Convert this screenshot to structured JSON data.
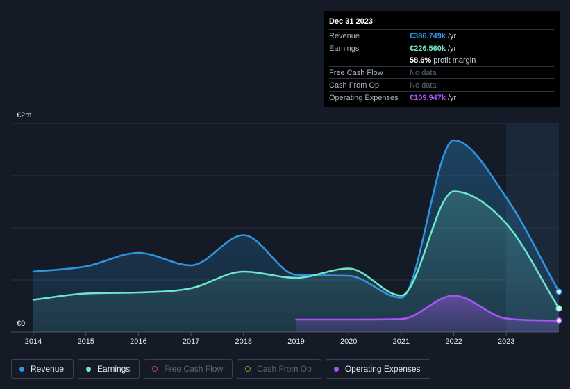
{
  "tooltip": {
    "date": "Dec 31 2023",
    "rows": [
      {
        "label": "Revenue",
        "value": "€386.749k",
        "unit": "/yr",
        "color": "#2f95e0"
      },
      {
        "label": "Earnings",
        "value": "€226.560k",
        "unit": "/yr",
        "color": "#6ee7c9"
      },
      {
        "label": "",
        "value": "58.6%",
        "unit": "profit margin",
        "color": "#ffffff"
      },
      {
        "label": "Free Cash Flow",
        "value": "No data",
        "unit": "",
        "color": "#5c6473"
      },
      {
        "label": "Cash From Op",
        "value": "No data",
        "unit": "",
        "color": "#5c6473"
      },
      {
        "label": "Operating Expenses",
        "value": "€109.947k",
        "unit": "/yr",
        "color": "#a855f7"
      }
    ]
  },
  "chart_data": {
    "type": "area",
    "y_axis": {
      "top_label": "€2m",
      "bottom_label": "€0",
      "ylim": [
        0,
        2000
      ]
    },
    "x_ticks": [
      "2014",
      "2015",
      "2016",
      "2017",
      "2018",
      "2019",
      "2020",
      "2021",
      "2022",
      "2023"
    ],
    "x_range": [
      2014.0,
      2024.0
    ],
    "units": "€k",
    "series": [
      {
        "name": "Revenue",
        "color": "#2f95e0",
        "points": [
          [
            2014.0,
            580
          ],
          [
            2015.0,
            630
          ],
          [
            2016.0,
            760
          ],
          [
            2017.0,
            640
          ],
          [
            2018.0,
            930
          ],
          [
            2019.0,
            550
          ],
          [
            2020.0,
            540
          ],
          [
            2021.0,
            330
          ],
          [
            2022.0,
            1840
          ],
          [
            2023.0,
            1290
          ],
          [
            2024.0,
            387
          ]
        ]
      },
      {
        "name": "Earnings",
        "color": "#6ee7c9",
        "points": [
          [
            2014.0,
            310
          ],
          [
            2015.0,
            370
          ],
          [
            2016.0,
            380
          ],
          [
            2017.0,
            420
          ],
          [
            2018.0,
            580
          ],
          [
            2019.0,
            520
          ],
          [
            2020.0,
            610
          ],
          [
            2021.0,
            350
          ],
          [
            2022.0,
            1350
          ],
          [
            2023.0,
            1040
          ],
          [
            2024.0,
            227
          ]
        ]
      },
      {
        "name": "Operating Expenses",
        "color": "#a855f7",
        "points": [
          [
            2019.0,
            120
          ],
          [
            2020.0,
            120
          ],
          [
            2021.0,
            125
          ],
          [
            2022.0,
            350
          ],
          [
            2023.0,
            130
          ],
          [
            2024.0,
            110
          ]
        ]
      }
    ]
  },
  "legend": [
    {
      "label": "Revenue",
      "color": "#2f95e0",
      "active": true
    },
    {
      "label": "Earnings",
      "color": "#6ee7c9",
      "active": true
    },
    {
      "label": "Free Cash Flow",
      "color": "#b3455b",
      "active": false
    },
    {
      "label": "Cash From Op",
      "color": "#a38a3a",
      "active": false
    },
    {
      "label": "Operating Expenses",
      "color": "#a855f7",
      "active": true
    }
  ]
}
